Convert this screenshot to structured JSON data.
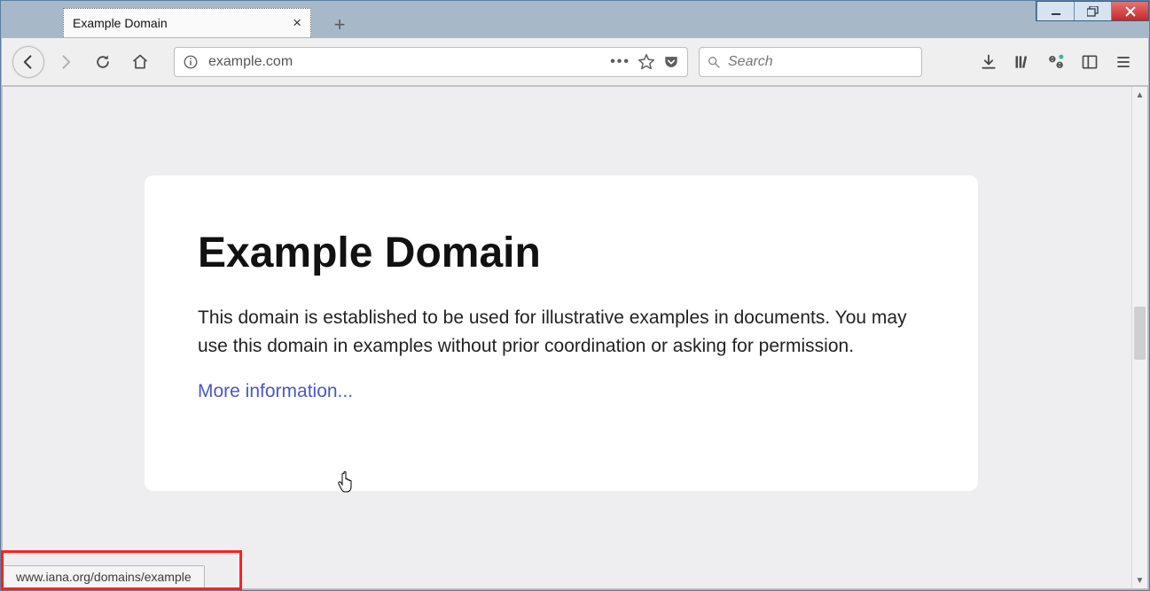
{
  "window": {
    "min_tip": "Minimize",
    "max_tip": "Restore",
    "close_tip": "Close"
  },
  "tab": {
    "title": "Example Domain"
  },
  "toolbar": {
    "url": "example.com",
    "search_placeholder": "Search"
  },
  "page": {
    "heading": "Example Domain",
    "body": "This domain is established to be used for illustrative examples in documents. You may use this domain in examples without prior coordination or asking for permission.",
    "link_text": "More information..."
  },
  "status": {
    "hover_url": "www.iana.org/domains/example"
  }
}
